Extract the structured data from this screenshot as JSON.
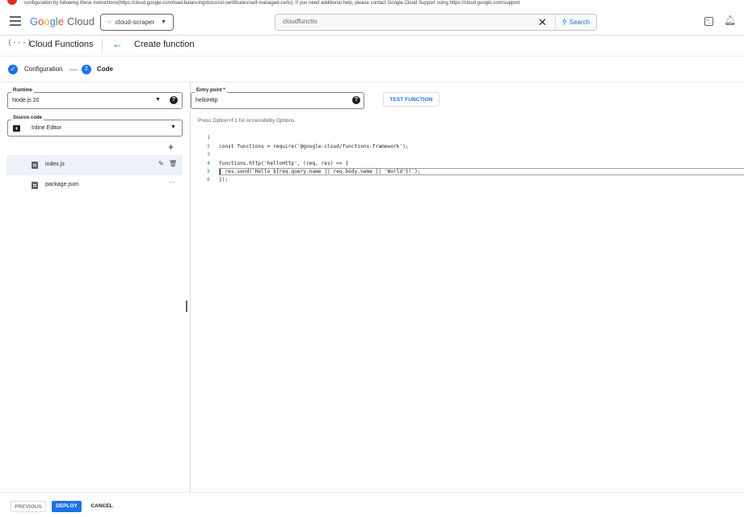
{
  "notice": {
    "text": "configuration by following these instructions(https://cloud.google.com/load-balancing/docs/ssl-certificates/self-managed-certs). If you need additional help, please contact Google Cloud Support using https://cloud.google.com/support"
  },
  "topbar": {
    "logo_google": [
      "G",
      "o",
      "o",
      "g",
      "l",
      "e"
    ],
    "logo_cloud": "Cloud",
    "project": "cloud-scraper",
    "search_value": "cloudfunctio",
    "search_button": "Search"
  },
  "titlebar": {
    "product": "Cloud Functions",
    "page_title": "Create function"
  },
  "stepper": {
    "step1_label": "Configuration",
    "step2_number": "2",
    "step2_label": "Code"
  },
  "runtime": {
    "label": "Runtime",
    "value": "Node.js 20"
  },
  "source_code": {
    "label": "Source code",
    "value": "Inline Editor"
  },
  "files": [
    {
      "name": "index.js"
    },
    {
      "name": "package.json"
    }
  ],
  "entry_point": {
    "label": "Entry point *",
    "value": "helloHttp"
  },
  "test_button": "TEST FUNCTION",
  "editor": {
    "hint": "Press Option+F1 for Accessibility Options.",
    "line_numbers": [
      "1",
      "2",
      "3",
      "4",
      "5",
      "6"
    ],
    "lines": [
      "const functions = require('@google-cloud/functions-framework');",
      "",
      "functions.http('helloHttp', (req, res) => {",
      "  res.send(`Hello ${req.query.name || req.body.name || 'World'}!`);",
      "});",
      ""
    ]
  },
  "footer": {
    "previous": "PREVIOUS",
    "deploy": "DEPLOY",
    "cancel": "CANCEL"
  },
  "colors": {
    "accent": "#1a73e8",
    "error_dot": "#d93025"
  }
}
